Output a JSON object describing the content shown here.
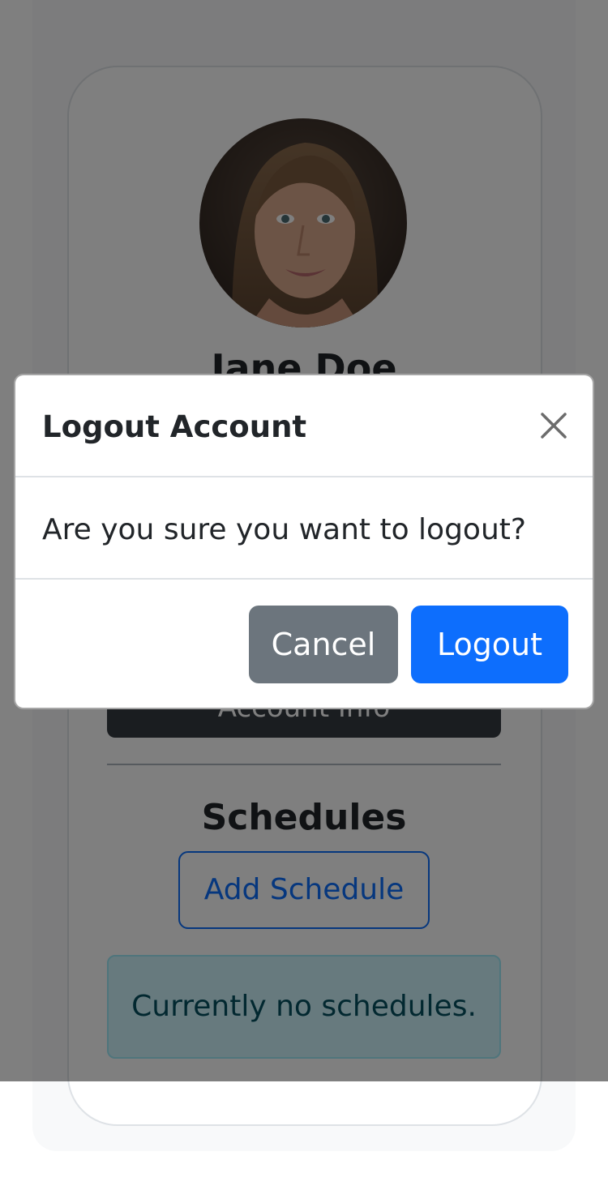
{
  "profile": {
    "name": "Jane Doe",
    "avatar_icon": "user-avatar-photo",
    "account_info_label": "Account Info"
  },
  "schedules": {
    "heading": "Schedules",
    "add_label": "Add Schedule",
    "empty_message": "Currently no schedules."
  },
  "modal": {
    "title": "Logout Account",
    "close_icon": "close-icon",
    "message": "Are you sure you want to logout?",
    "cancel_label": "Cancel",
    "logout_label": "Logout"
  },
  "colors": {
    "primary": "#0d6efd",
    "secondary": "#6c757d",
    "dark": "#343a40",
    "info_bg": "#cff4fc",
    "info_text": "#055160",
    "backdrop": "rgba(0,0,0,0.5)"
  }
}
